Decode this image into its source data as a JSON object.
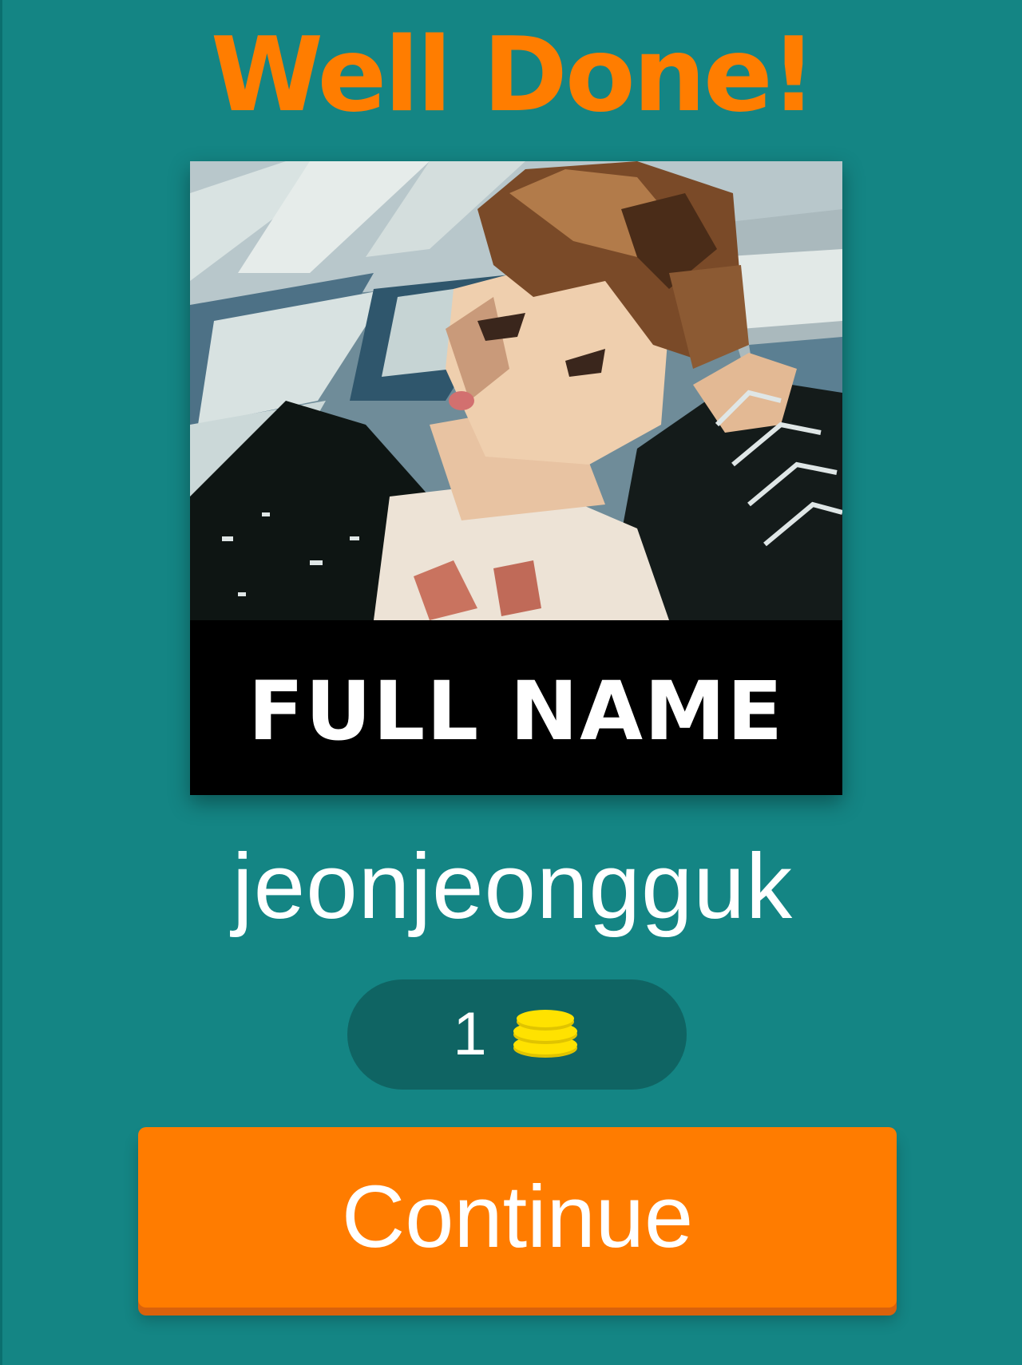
{
  "header": {
    "title": "Well Done!"
  },
  "puzzle": {
    "image_caption": "FULL NAME",
    "answer": "jeonjeongguk"
  },
  "reward": {
    "amount": "1",
    "icon": "coin-stack-icon"
  },
  "actions": {
    "continue_label": "Continue"
  },
  "colors": {
    "background": "#148584",
    "accent": "#ff7c00",
    "reward_pill": "#0f6463",
    "coin": "#ffe200"
  }
}
